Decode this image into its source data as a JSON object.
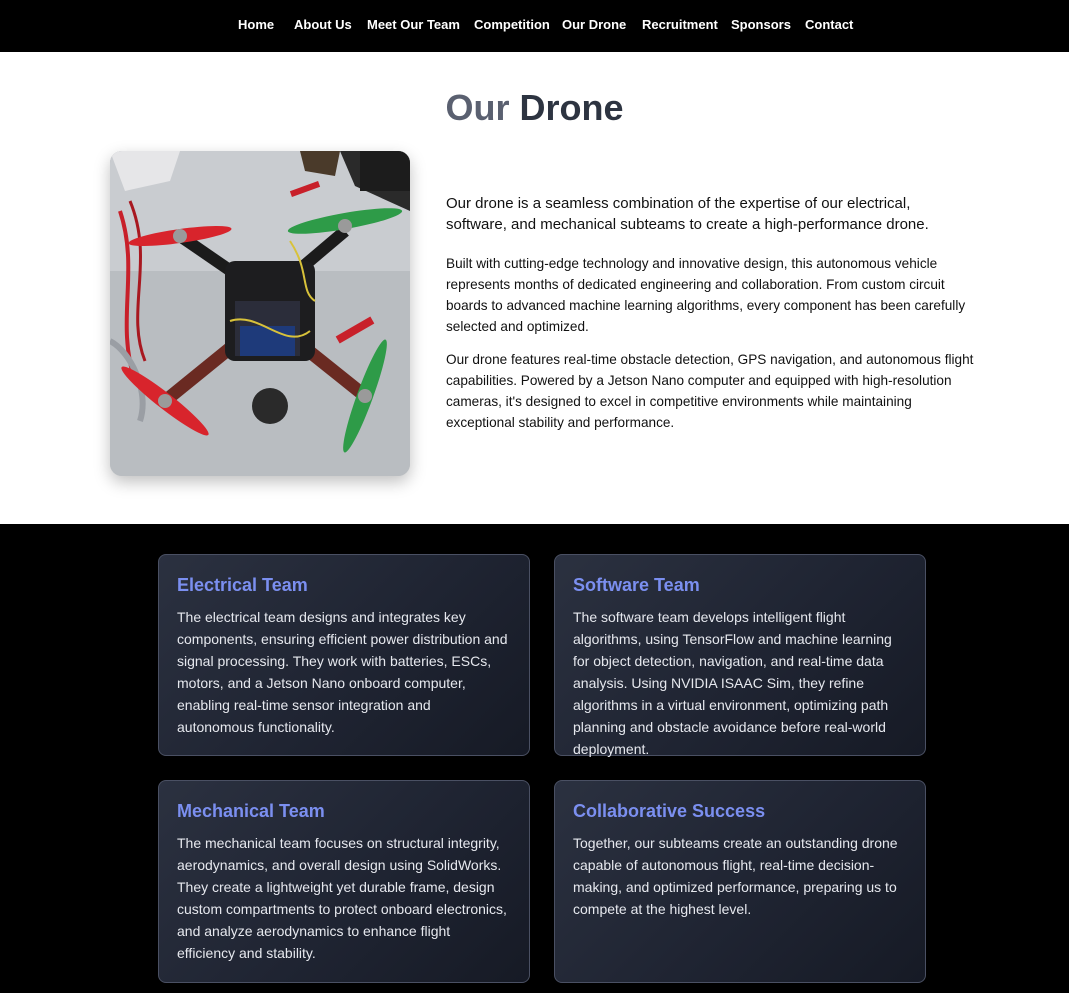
{
  "nav": {
    "items": [
      {
        "label": "Home"
      },
      {
        "label": "About Us"
      },
      {
        "label": "Meet Our Team"
      },
      {
        "label": "Competition"
      },
      {
        "label": "Our Drone"
      },
      {
        "label": "Recruitment"
      },
      {
        "label": "Sponsors"
      },
      {
        "label": "Contact"
      }
    ]
  },
  "hero": {
    "title_part1": "Our",
    "title_part2": "Drone",
    "lead": "Our drone is a seamless combination of the expertise of our electrical, software, and mechanical subteams to create a high-performance drone.",
    "paragraph1": "Built with cutting-edge technology and innovative design, this autonomous vehicle represents months of dedicated engineering and collaboration. From custom circuit boards to advanced machine learning algorithms, every component has been carefully selected and optimized.",
    "paragraph2": "Our drone features real-time obstacle detection, GPS navigation, and autonomous flight capabilities. Powered by a Jetson Nano computer and equipped with high-resolution cameras, it's designed to excel in competitive environments while maintaining exceptional stability and performance."
  },
  "teams": [
    {
      "title": "Electrical Team",
      "text": "The electrical team designs and integrates key components, ensuring efficient power distribution and signal processing. They work with batteries, ESCs, motors, and a Jetson Nano onboard computer, enabling real-time sensor integration and autonomous functionality."
    },
    {
      "title": "Software Team",
      "text": "The software team develops intelligent flight algorithms, using TensorFlow and machine learning for object detection, navigation, and real-time data analysis. Using NVIDIA ISAAC Sim, they refine algorithms in a virtual environment, optimizing path planning and obstacle avoidance before real-world deployment."
    },
    {
      "title": "Mechanical Team",
      "text": "The mechanical team focuses on structural integrity, aerodynamics, and overall design using SolidWorks. They create a lightweight yet durable frame, design custom compartments to protect onboard electronics, and analyze aerodynamics to enhance flight efficiency and stability."
    },
    {
      "title": "Collaborative Success",
      "text": "Together, our subteams create an outstanding drone capable of autonomous flight, real-time decision-making, and optimized performance, preparing us to compete at the highest level."
    }
  ],
  "colors": {
    "nav_bg": "#000000",
    "card_title": "#7b8ff0",
    "page_title": "#2d3441"
  }
}
